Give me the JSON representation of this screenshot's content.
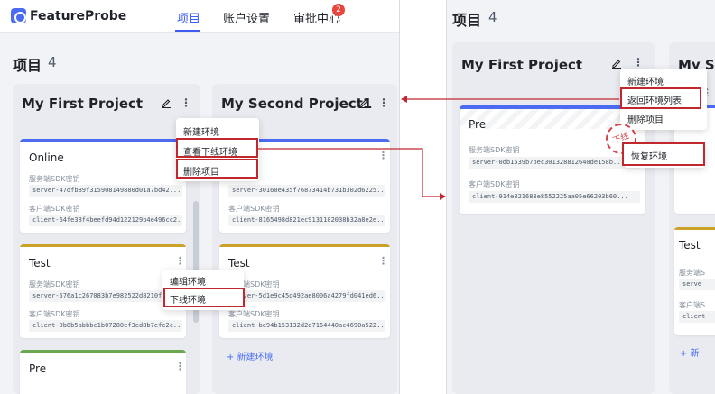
{
  "left": {
    "logo_text": "FeatureProbe",
    "nav": [
      {
        "label": "项目"
      },
      {
        "label": "账户设置"
      },
      {
        "label": "审批中心"
      }
    ],
    "badge_count": "2",
    "page_title": "项目",
    "page_count": "4",
    "projects": [
      {
        "title": "My First Project",
        "envs": [
          {
            "name": "Online",
            "server_label": "服务端SDK密钥",
            "server_key": "server-47dfb89f315908149880d01a7bd42...",
            "client_label": "客户端SDK密钥",
            "client_key": "client-64fe38f4beefd94d122129b4e496cc2..."
          },
          {
            "name": "Test",
            "server_label": "服务端SDK密钥",
            "server_key": "server-576a1c267083b7e982522d8210fb6...",
            "client_label": "客户端SDK密钥",
            "client_key": "client-0b8b5abbbc1b07280ef3ed8b7efc2c..."
          },
          {
            "name": "Pre"
          }
        ]
      },
      {
        "title": "My Second Project1",
        "envs": [
          {
            "name": "Online",
            "server_label": "服务端SDK密钥",
            "server_key": "server-30160e435f76873414b731b302d6225...",
            "client_label": "客户端SDK密钥",
            "client_key": "client-8165498d821ec9131102038b32a8e2e..."
          },
          {
            "name": "Test",
            "server_label": "服务端SDK密钥",
            "server_key": "server-5d1e9c45d492ae8006a4279fd041ed6...",
            "client_label": "客户端SDK密钥",
            "client_key": "client-be94b153132d2d7164440ac4690a522..."
          }
        ],
        "add_env": "+ 新建环境"
      }
    ],
    "project_menu": [
      "新建环境",
      "查看下线环境",
      "删除项目"
    ],
    "env_menu": [
      "编辑环境",
      "下线环境"
    ]
  },
  "right": {
    "page_title": "项目",
    "page_count": "4",
    "project_title": "My First Project",
    "project_title_2": "My Se",
    "project_menu": [
      "新建环境",
      "返回环境列表",
      "删除项目"
    ],
    "env": {
      "name": "Pre",
      "server_label": "服务端SDK密钥",
      "server_key": "server-0db1539b7bec301328812640de158b...",
      "client_label": "客户端SDK密钥",
      "client_key": "client-914e821683e8552225aa05e66203b60..."
    },
    "stamp_text": "下线",
    "restore_label": "恢复环境",
    "side_partial": {
      "ne": "ne",
      "test": "Test",
      "server_label": "服务端S",
      "server_key": "serve",
      "client_label": "客户端S",
      "client_key": "client",
      "add": "+ 新",
      "shu": "述"
    }
  },
  "colors": {
    "accent": "#3e5cf0",
    "online_bar": "#4a6bf2",
    "test_bar": "#c9a227",
    "pre_bar": "#6aa84f",
    "highlight": "#c0282e"
  }
}
